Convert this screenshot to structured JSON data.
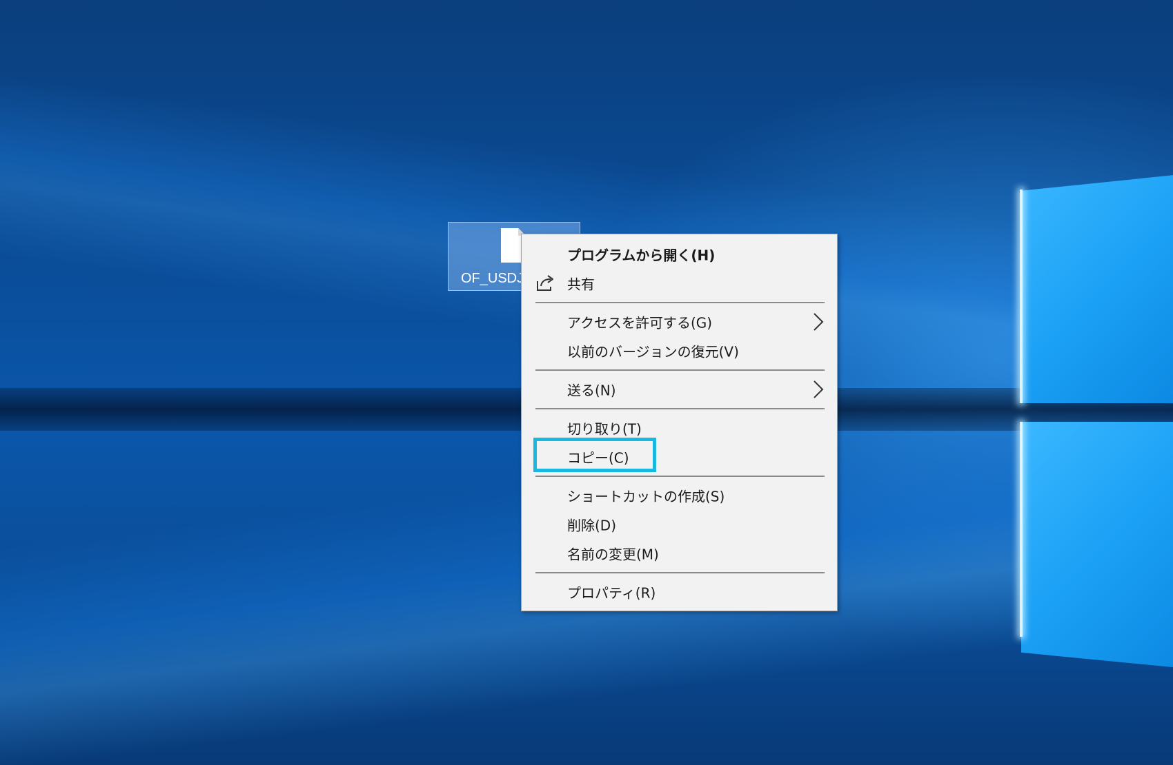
{
  "desktop": {
    "icon": {
      "label": "OF_USDJ",
      "icon": "file-icon"
    }
  },
  "context_menu": {
    "items": [
      {
        "label": "プログラムから開く(H)",
        "bold": true
      },
      {
        "label": "共有",
        "icon": "share-icon"
      },
      {
        "label": "アクセスを許可する(G)",
        "submenu": true
      },
      {
        "label": "以前のバージョンの復元(V)"
      },
      {
        "label": "送る(N)",
        "submenu": true
      },
      {
        "label": "切り取り(T)"
      },
      {
        "label": "コピー(C)",
        "highlighted": true
      },
      {
        "label": "ショートカットの作成(S)"
      },
      {
        "label": "削除(D)"
      },
      {
        "label": "名前の変更(M)"
      },
      {
        "label": "プロパティ(R)"
      }
    ]
  },
  "colors": {
    "menu_background": "#f2f2f2",
    "highlight_border": "#1ab8e0",
    "desktop_blue": "#0b57ab"
  }
}
